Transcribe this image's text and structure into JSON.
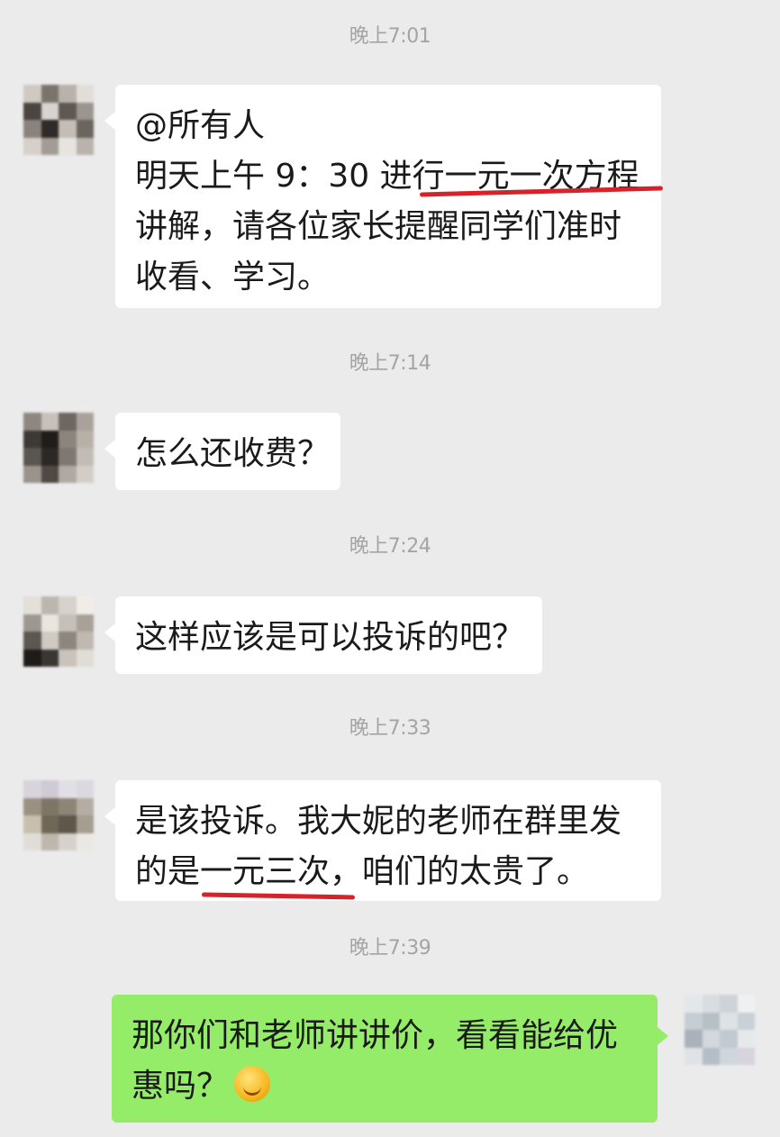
{
  "messages": [
    {
      "time": "晚上7:01",
      "lines": [
        "@所有人",
        "明天上午 9：30 进行一元一次方程",
        "讲解，请各位家长提醒同学们准时",
        "收看、学习。"
      ]
    },
    {
      "time": "晚上7:14",
      "lines": [
        "怎么还收费？"
      ]
    },
    {
      "time": "晚上7:24",
      "lines": [
        "这样应该是可以投诉的吧？"
      ]
    },
    {
      "time": "晚上7:33",
      "lines": [
        "是该投诉。我大妮的老师在群里发",
        "的是一元三次，咱们的太贵了。"
      ]
    },
    {
      "time": "晚上7:39",
      "lines": [
        "那你们和老师讲讲价，看看能给优",
        "惠吗？"
      ]
    }
  ],
  "emoji": "grinning-sweat-emoji",
  "colors": {
    "background": "#ebebeb",
    "incoming_bubble": "#ffffff",
    "outgoing_bubble": "#95ec69",
    "timestamp": "#a4a4a4",
    "annotation_underline": "#d8222a"
  }
}
